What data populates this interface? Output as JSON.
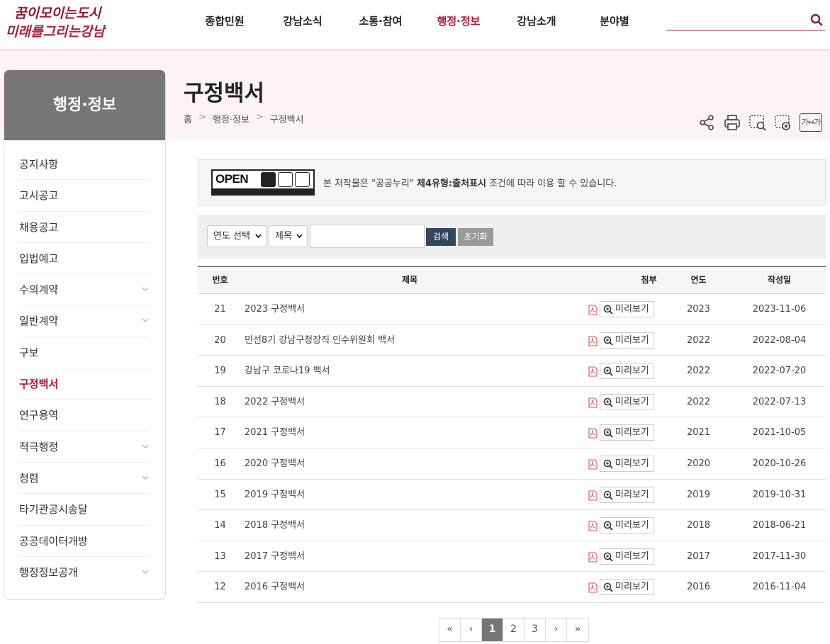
{
  "header": {
    "logo_line1": "꿈이모이는도시",
    "logo_line2": "미래를그리는강남",
    "nav": [
      {
        "label": "종합민원",
        "active": false
      },
      {
        "label": "강남소식",
        "active": false
      },
      {
        "label": "소통·참여",
        "active": false
      },
      {
        "label": "행정·정보",
        "active": true
      },
      {
        "label": "강남소개",
        "active": false
      },
      {
        "label": "분야별",
        "active": false
      }
    ],
    "search_value": ""
  },
  "sidebar": {
    "title": "행정·정보",
    "items": [
      {
        "label": "공지사항",
        "has_sub": false,
        "active": false
      },
      {
        "label": "고시공고",
        "has_sub": false,
        "active": false
      },
      {
        "label": "채용공고",
        "has_sub": false,
        "active": false
      },
      {
        "label": "입법예고",
        "has_sub": false,
        "active": false
      },
      {
        "label": "수의계약",
        "has_sub": true,
        "active": false
      },
      {
        "label": "일반계약",
        "has_sub": true,
        "active": false
      },
      {
        "label": "구보",
        "has_sub": false,
        "active": false
      },
      {
        "label": "구정백서",
        "has_sub": false,
        "active": true
      },
      {
        "label": "연구용역",
        "has_sub": false,
        "active": false
      },
      {
        "label": "적극행정",
        "has_sub": true,
        "active": false
      },
      {
        "label": "청렴",
        "has_sub": true,
        "active": false
      },
      {
        "label": "타기관공시송달",
        "has_sub": false,
        "active": false
      },
      {
        "label": "공공데이터개방",
        "has_sub": false,
        "active": false
      },
      {
        "label": "행정정보공개",
        "has_sub": true,
        "active": false
      }
    ]
  },
  "page": {
    "title": "구정백서",
    "breadcrumb": [
      "홈",
      "행정·정보",
      "구정백서"
    ],
    "tools": [
      "share-icon",
      "print-icon",
      "zoom-out-icon",
      "zoom-in-icon",
      "font-size-icon"
    ],
    "tool_font_label": "가↔가"
  },
  "license": {
    "badge_text": "OPEN",
    "text_prefix": "본 저작물은 \"공공누리\" ",
    "text_bold": "제4유형:출처표시",
    "text_suffix": " 조건에 따라 이용 할 수 있습니다."
  },
  "search_form": {
    "year_select": "연도 선택",
    "field_select": "제목",
    "keyword_value": "",
    "search_label": "검색",
    "reset_label": "초기화"
  },
  "table": {
    "headers": {
      "no": "번호",
      "title": "제목",
      "attachment": "첨부",
      "year": "연도",
      "date": "작성일"
    },
    "preview_label": "미리보기",
    "rows": [
      {
        "no": "21",
        "title": "2023 구정백서",
        "year": "2023",
        "date": "2023-11-06"
      },
      {
        "no": "20",
        "title": "민선8기 강남구청장직 인수위원회 백서",
        "year": "2022",
        "date": "2022-08-04"
      },
      {
        "no": "19",
        "title": "강남구 코로나19 백서",
        "year": "2022",
        "date": "2022-07-20"
      },
      {
        "no": "18",
        "title": "2022 구정백서",
        "year": "2022",
        "date": "2022-07-13"
      },
      {
        "no": "17",
        "title": "2021 구정백서",
        "year": "2021",
        "date": "2021-10-05"
      },
      {
        "no": "16",
        "title": "2020 구정백서",
        "year": "2020",
        "date": "2020-10-26"
      },
      {
        "no": "15",
        "title": "2019 구정백서",
        "year": "2019",
        "date": "2019-10-31"
      },
      {
        "no": "14",
        "title": "2018 구정백서",
        "year": "2018",
        "date": "2018-06-21"
      },
      {
        "no": "13",
        "title": "2017 구정백서",
        "year": "2017",
        "date": "2017-11-30"
      },
      {
        "no": "12",
        "title": "2016 구정백서",
        "year": "2016",
        "date": "2016-11-04"
      }
    ]
  },
  "pagination": {
    "first": "«",
    "prev": "‹",
    "next": "›",
    "last": "»",
    "pages": [
      "1",
      "2",
      "3"
    ],
    "current": "1"
  },
  "colors": {
    "accent": "#b0183a",
    "sidebar_head": "#767676",
    "search_button": "#34465e",
    "band": "#fbf3f4"
  }
}
